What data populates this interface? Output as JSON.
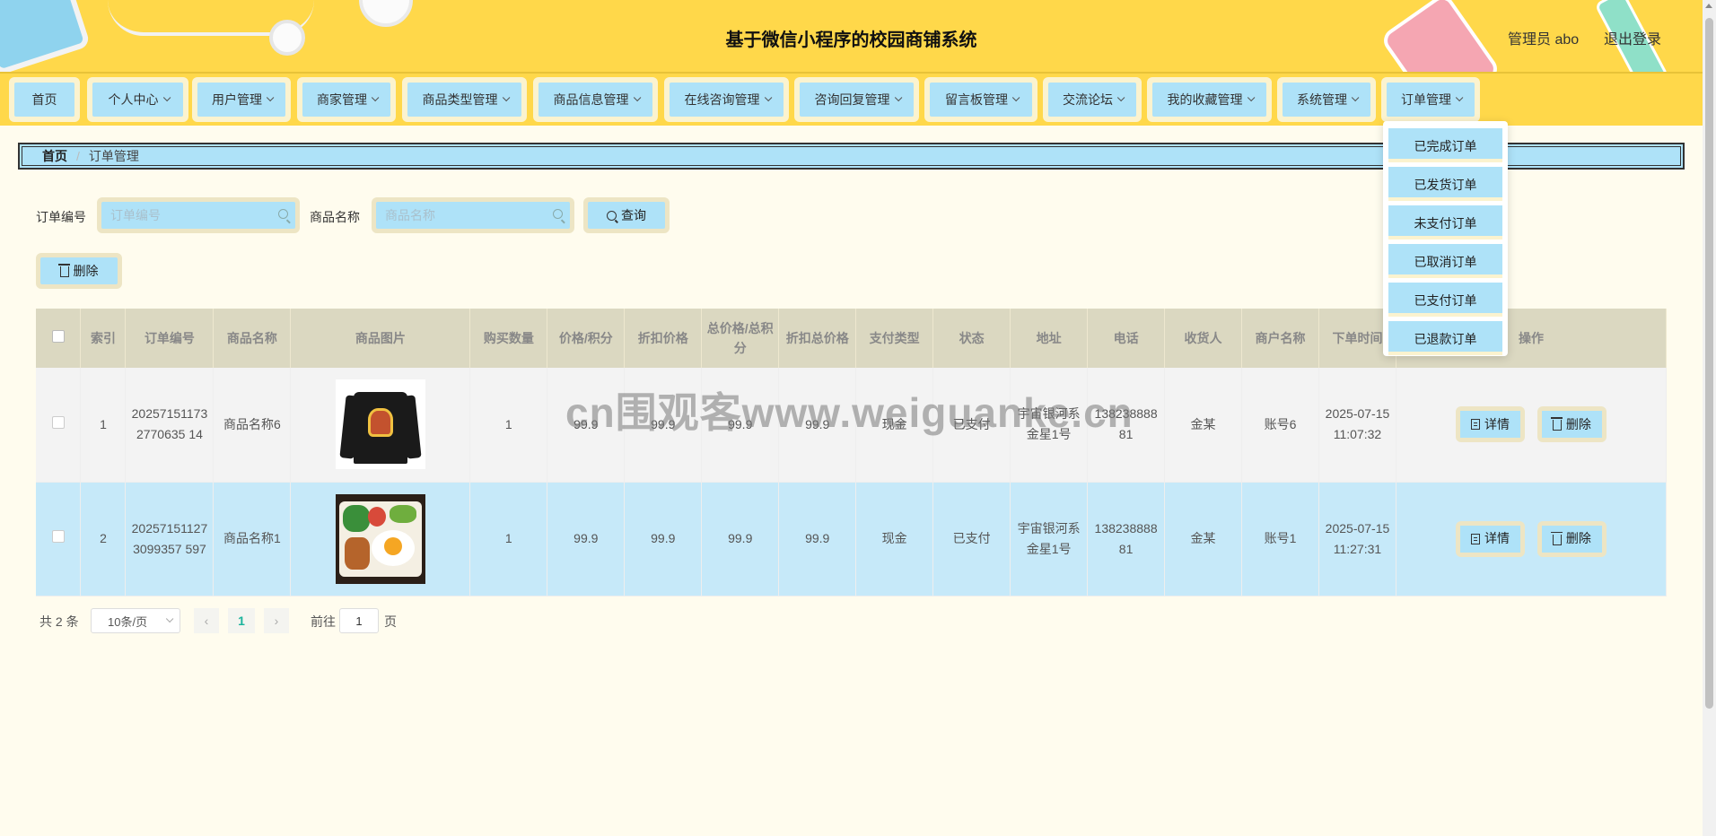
{
  "header": {
    "title": "基于微信小程序的校园商铺系统",
    "user": "管理员 abo",
    "logout": "退出登录"
  },
  "nav": {
    "items": [
      {
        "label": "首页",
        "has_dropdown": false
      },
      {
        "label": "个人中心",
        "has_dropdown": true
      },
      {
        "label": "用户管理",
        "has_dropdown": true
      },
      {
        "label": "商家管理",
        "has_dropdown": true
      },
      {
        "label": "商品类型管理",
        "has_dropdown": true
      },
      {
        "label": "商品信息管理",
        "has_dropdown": true
      },
      {
        "label": "在线咨询管理",
        "has_dropdown": true
      },
      {
        "label": "咨询回复管理",
        "has_dropdown": true
      },
      {
        "label": "留言板管理",
        "has_dropdown": true
      },
      {
        "label": "交流论坛",
        "has_dropdown": true
      },
      {
        "label": "我的收藏管理",
        "has_dropdown": true
      },
      {
        "label": "系统管理",
        "has_dropdown": true
      },
      {
        "label": "订单管理",
        "has_dropdown": true
      }
    ],
    "dropdown": [
      "已完成订单",
      "已发货订单",
      "未支付订单",
      "已取消订单",
      "已支付订单",
      "已退款订单"
    ]
  },
  "breadcrumb": {
    "home": "首页",
    "separator": "/",
    "current": "订单管理"
  },
  "search": {
    "order_no_label": "订单编号",
    "order_no_placeholder": "订单编号",
    "product_label": "商品名称",
    "product_placeholder": "商品名称",
    "query_button": "查询"
  },
  "actions": {
    "delete_button": "删除"
  },
  "table": {
    "columns": [
      "索引",
      "订单编号",
      "商品名称",
      "商品图片",
      "购买数量",
      "价格/积分",
      "折扣价格",
      "总价格/总积分",
      "折扣总价格",
      "支付类型",
      "状态",
      "地址",
      "电话",
      "收货人",
      "商户名称",
      "下单时间",
      "操作"
    ],
    "rows": [
      {
        "index": "1",
        "order_no": "202571511732770635 14",
        "product": "商品名称6",
        "image": "shirt-image",
        "qty": "1",
        "price": "99.9",
        "discount_price": "99.9",
        "total": "99.9",
        "discount_total": "99.9",
        "pay_type": "现金",
        "status": "已支付",
        "address": "宇宙银河系金星1号",
        "phone": "13823888881",
        "receiver": "金某",
        "merchant": "账号6",
        "time": "2025-07-15 11:07:32"
      },
      {
        "index": "2",
        "order_no": "202571511273099357 597",
        "product": "商品名称1",
        "image": "bento-image",
        "qty": "1",
        "price": "99.9",
        "discount_price": "99.9",
        "total": "99.9",
        "discount_total": "99.9",
        "pay_type": "现金",
        "status": "已支付",
        "address": "宇宙银河系金星1号",
        "phone": "13823888881",
        "receiver": "金某",
        "merchant": "账号1",
        "time": "2025-07-15 11:27:31"
      }
    ],
    "detail_button": "详情",
    "delete_button": "删除"
  },
  "pagination": {
    "total": "共 2 条",
    "page_size": "10条/页",
    "prev": "‹",
    "current_page": "1",
    "next": "›",
    "goto_label": "前往",
    "goto_value": "1",
    "page_suffix": "页"
  },
  "watermark": "cn围观客www.weiguanke.cn",
  "colors": {
    "header_bg": "#ffd84a",
    "button_bg": "#aee2f8",
    "button_border": "#ede5c4",
    "page_bg": "#fffcee",
    "selected_row": "#c6e9f9",
    "active_page": "#1bb39c"
  }
}
